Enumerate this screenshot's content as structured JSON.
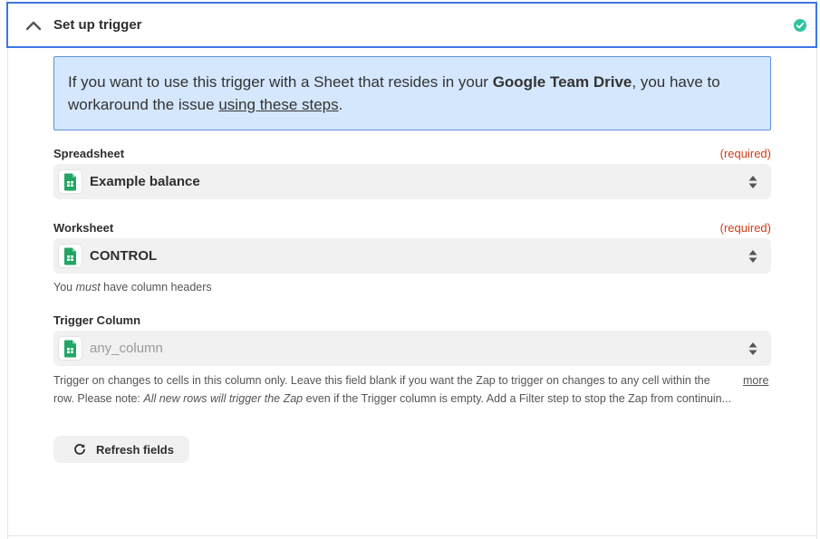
{
  "header": {
    "title": "Set up trigger",
    "status_icon": "check-circle-icon",
    "accent": "#3d76e3",
    "status_color": "#2ec4a1"
  },
  "info": {
    "text_before": "If you want to use this trigger with a Sheet that resides in your ",
    "bold_text": "Google Team Drive",
    "text_middle": ", you have to workaround the issue ",
    "link_text": "using these steps",
    "text_after": "."
  },
  "spreadsheet": {
    "label": "Spreadsheet",
    "required": "(required)",
    "value": "Example balance",
    "icon": "google-sheets-icon"
  },
  "worksheet": {
    "label": "Worksheet",
    "required": "(required)",
    "value": "CONTROL",
    "icon": "google-sheets-icon",
    "help_before": "You ",
    "help_em": "must",
    "help_after": " have column headers"
  },
  "trigger_column": {
    "label": "Trigger Column",
    "placeholder": "any_column",
    "icon": "google-sheets-icon",
    "help_line1": "Trigger on changes to cells in this column only. Leave this field blank if you want the Zap to trigger on changes to any cell within the",
    "help_line2_before": "row. Please note: ",
    "help_line2_em": "All new rows will trigger the Zap",
    "help_line2_after": " even if the Trigger column is empty. Add a Filter step to stop the Zap from continuin...",
    "more_label": "more"
  },
  "refresh": {
    "label": "Refresh fields",
    "icon": "refresh-icon"
  }
}
